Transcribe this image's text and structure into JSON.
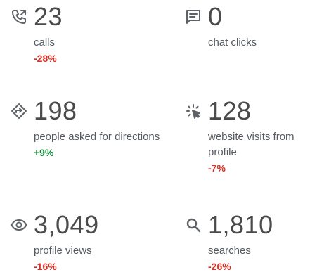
{
  "metrics": {
    "calls": {
      "icon": "phone-icon",
      "value": "23",
      "label": "calls",
      "change": "-28%",
      "trend": "negative"
    },
    "chat_clicks": {
      "icon": "chat-icon",
      "value": "0",
      "label": "chat clicks",
      "change": "",
      "trend": "none"
    },
    "directions": {
      "icon": "directions-icon",
      "value": "198",
      "label": "people asked for directions",
      "change": "+9%",
      "trend": "positive"
    },
    "website_visits": {
      "icon": "click-icon",
      "value": "128",
      "label": "website visits from profile",
      "change": "-7%",
      "trend": "negative"
    },
    "profile_views": {
      "icon": "eye-icon",
      "value": "3,049",
      "label": "profile views",
      "change": "-16%",
      "trend": "negative"
    },
    "searches": {
      "icon": "search-icon",
      "value": "1,810",
      "label": "searches",
      "change": "-26%",
      "trend": "negative"
    }
  },
  "colors": {
    "negative": "#d93025",
    "positive": "#188038",
    "icon": "#5f6368",
    "value": "#4a4a4a",
    "label": "#555a60"
  }
}
